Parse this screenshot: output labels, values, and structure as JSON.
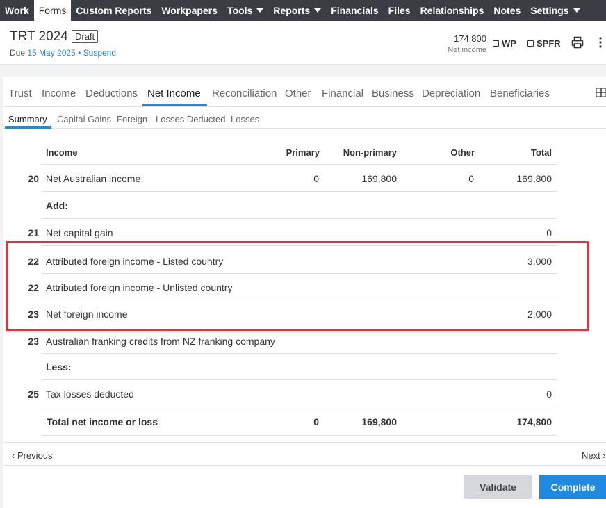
{
  "nav": {
    "items": [
      {
        "label": "Work",
        "active": false,
        "caret": false
      },
      {
        "label": "Forms",
        "active": true,
        "caret": false
      },
      {
        "label": "Custom Reports",
        "active": false,
        "caret": false
      },
      {
        "label": "Workpapers",
        "active": false,
        "caret": false
      },
      {
        "label": "Tools",
        "active": false,
        "caret": true
      },
      {
        "label": "Reports",
        "active": false,
        "caret": true
      },
      {
        "label": "Financials",
        "active": false,
        "caret": false
      },
      {
        "label": "Files",
        "active": false,
        "caret": false
      },
      {
        "label": "Relationships",
        "active": false,
        "caret": false
      },
      {
        "label": "Notes",
        "active": false,
        "caret": false
      },
      {
        "label": "Settings",
        "active": false,
        "caret": true
      }
    ]
  },
  "header": {
    "title": "TRT 2024",
    "status": "Draft",
    "due_prefix": "Due",
    "due_date": "15 May 2025",
    "separator": "•",
    "suspend_link": "Suspend",
    "net_income_value": "174,800",
    "net_income_label": "Net income",
    "wp_label": "WP",
    "spfr_label": "SPFR"
  },
  "tabs": [
    "Trust",
    "Income",
    "Deductions",
    "Net Income",
    "Reconciliation",
    "Other",
    "Financial",
    "Business",
    "Depreciation",
    "Beneficiaries"
  ],
  "active_tab": "Net Income",
  "subtabs": [
    "Summary",
    "Capital Gains",
    "Foreign",
    "Losses Deducted",
    "Losses"
  ],
  "active_subtab": "Summary",
  "table": {
    "headers": {
      "income": "Income",
      "primary": "Primary",
      "non_primary": "Non-primary",
      "other": "Other",
      "total": "Total"
    },
    "rows": [
      {
        "label_no": "20",
        "desc": "Net Australian income",
        "primary": "0",
        "non_primary": "169,800",
        "other": "0",
        "total": "169,800"
      },
      {
        "label_no": "",
        "desc": "Add:",
        "primary": "",
        "non_primary": "",
        "other": "",
        "total": ""
      },
      {
        "label_no": "21",
        "desc": "Net capital gain",
        "primary": "",
        "non_primary": "",
        "other": "",
        "total": "0"
      },
      {
        "label_no": "22",
        "desc": "Attributed foreign income - Listed country",
        "primary": "",
        "non_primary": "",
        "other": "",
        "total": "3,000"
      },
      {
        "label_no": "22",
        "desc": "Attributed foreign income - Unlisted country",
        "primary": "",
        "non_primary": "",
        "other": "",
        "total": ""
      },
      {
        "label_no": "23",
        "desc": "Net foreign income",
        "primary": "",
        "non_primary": "",
        "other": "",
        "total": "2,000"
      },
      {
        "label_no": "23",
        "desc": "Australian franking credits from NZ franking company",
        "primary": "",
        "non_primary": "",
        "other": "",
        "total": ""
      },
      {
        "label_no": "",
        "desc": "Less:",
        "primary": "",
        "non_primary": "",
        "other": "",
        "total": ""
      },
      {
        "label_no": "25",
        "desc": "Tax losses deducted",
        "primary": "",
        "non_primary": "",
        "other": "",
        "total": "0"
      },
      {
        "label_no": "",
        "desc": "Total net income or loss",
        "primary": "0",
        "non_primary": "169,800",
        "other": "",
        "total": "174,800"
      }
    ]
  },
  "footer": {
    "previous": "Previous",
    "next": "Next",
    "validate": "Validate",
    "complete": "Complete"
  },
  "colors": {
    "nav_bg": "#3b3d44",
    "accent": "#1f8ae0",
    "highlight": "#e0333d"
  }
}
